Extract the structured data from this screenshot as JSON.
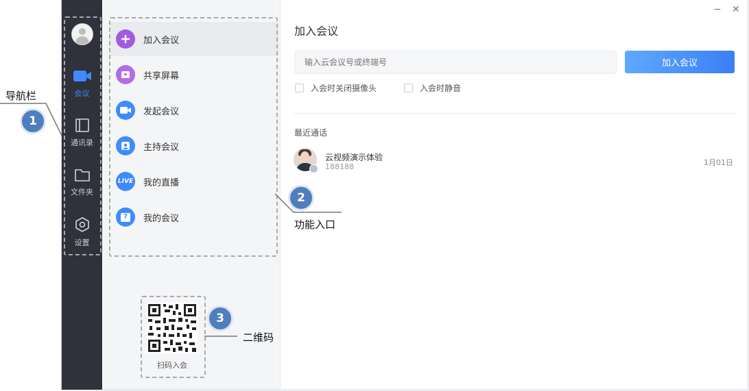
{
  "nav": {
    "items": [
      {
        "label": "会议",
        "icon": "video-camera-icon",
        "active": true
      },
      {
        "label": "通讯录",
        "icon": "contacts-book-icon",
        "active": false
      },
      {
        "label": "文件夹",
        "icon": "folder-icon",
        "active": false
      },
      {
        "label": "设置",
        "icon": "settings-hexagon-icon",
        "active": false
      }
    ]
  },
  "menu": {
    "items": [
      {
        "label": "加入会议",
        "icon": "plus-icon",
        "color": "#a25be0"
      },
      {
        "label": "共享屏幕",
        "icon": "upload-screen-icon",
        "color": "#b26de6"
      },
      {
        "label": "发起会议",
        "icon": "video-icon",
        "color": "#3d8bff"
      },
      {
        "label": "主持会议",
        "icon": "host-user-icon",
        "color": "#3d8bff"
      },
      {
        "label": "我的直播",
        "icon": "live-icon",
        "icon_text": "LIVE",
        "color": "#3d8bff"
      },
      {
        "label": "我的会议",
        "icon": "calendar-icon",
        "icon_text": "7",
        "color": "#3d8bff"
      }
    ],
    "qr_label": "扫码入会"
  },
  "content": {
    "title": "加入会议",
    "input_placeholder": "输入云会议号或终端号",
    "join_button": "加入会议",
    "checkboxes": [
      {
        "label": "入会时关闭摄像头",
        "checked": false
      },
      {
        "label": "入会时静音",
        "checked": false
      }
    ],
    "recent_title": "最近通话",
    "recent": [
      {
        "name": "云视频演示体验",
        "number": "188188",
        "date": "1月01日"
      }
    ]
  },
  "window": {
    "minimize": "−",
    "close": "✕"
  },
  "annotations": [
    {
      "number": "1",
      "text": "导航栏"
    },
    {
      "number": "2",
      "text": "功能入口"
    },
    {
      "number": "3",
      "text": "二维码"
    }
  ],
  "colors": {
    "nav_bg": "#2f323a",
    "accent": "#3d8bff",
    "annotation": "#4f7ebd"
  }
}
